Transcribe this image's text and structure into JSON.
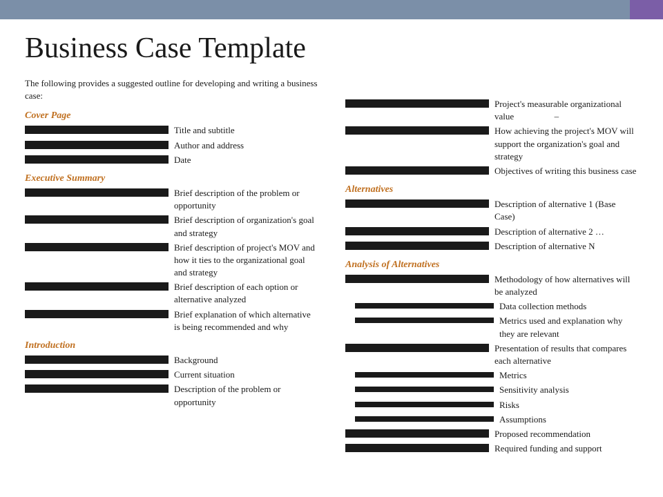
{
  "topBar": {
    "mainColor": "#7b8fa8",
    "accentColor": "#7b5ea7"
  },
  "title": "Business Case Template",
  "leftCol": {
    "introText": "The following provides a suggested outline for developing and writing a business case:",
    "sections": [
      {
        "heading": "Cover Page",
        "items": [
          {
            "text": "Title and subtitle",
            "level": "main"
          },
          {
            "text": "Author and address",
            "level": "main"
          },
          {
            "text": "Date",
            "level": "main"
          }
        ]
      },
      {
        "heading": "Executive Summary",
        "items": [
          {
            "text": "Brief description of the problem or opportunity",
            "level": "main"
          },
          {
            "text": "Brief description of organization's goal and strategy",
            "level": "main"
          },
          {
            "text": "Brief description of project's MOV and how it ties to the organizational goal and strategy",
            "level": "main"
          },
          {
            "text": "Brief description of each option or alternative analyzed",
            "level": "main"
          },
          {
            "text": "Brief explanation of which alternative is being recommended and why",
            "level": "main"
          }
        ]
      },
      {
        "heading": "Introduction",
        "items": [
          {
            "text": "Background",
            "level": "main"
          },
          {
            "text": "Current situation",
            "level": "main"
          },
          {
            "text": "Description of the problem or opportunity",
            "level": "main"
          }
        ]
      }
    ]
  },
  "rightCol": {
    "sections": [
      {
        "heading": null,
        "items": [
          {
            "text": "Project's measurable organizational value",
            "level": "main",
            "suffix": " –"
          },
          {
            "text": "How achieving the project's MOV will support the organization's goal and strategy",
            "level": "main"
          },
          {
            "text": "Objectives of writing this business case",
            "level": "main"
          }
        ]
      },
      {
        "heading": "Alternatives",
        "items": [
          {
            "text": "Description of alternative 1 (Base Case)",
            "level": "main"
          },
          {
            "text": "Description of alternative 2 …",
            "level": "main"
          },
          {
            "text": "Description of alternative N",
            "level": "main"
          }
        ]
      },
      {
        "heading": "Analysis of Alternatives",
        "items": [
          {
            "text": "Methodology of how alternatives will be analyzed",
            "level": "main"
          },
          {
            "text": "Data collection methods",
            "level": "sub"
          },
          {
            "text": "Metrics used and explanation why they are relevant",
            "level": "sub"
          },
          {
            "text": "Presentation of results that compares each alternative",
            "level": "main"
          },
          {
            "text": "Metrics",
            "level": "sub"
          },
          {
            "text": "Sensitivity analysis",
            "level": "sub"
          },
          {
            "text": "Risks",
            "level": "sub"
          },
          {
            "text": "Assumptions",
            "level": "sub"
          },
          {
            "text": "Proposed recommendation",
            "level": "main"
          },
          {
            "text": "Required funding and support",
            "level": "main"
          }
        ]
      }
    ]
  }
}
